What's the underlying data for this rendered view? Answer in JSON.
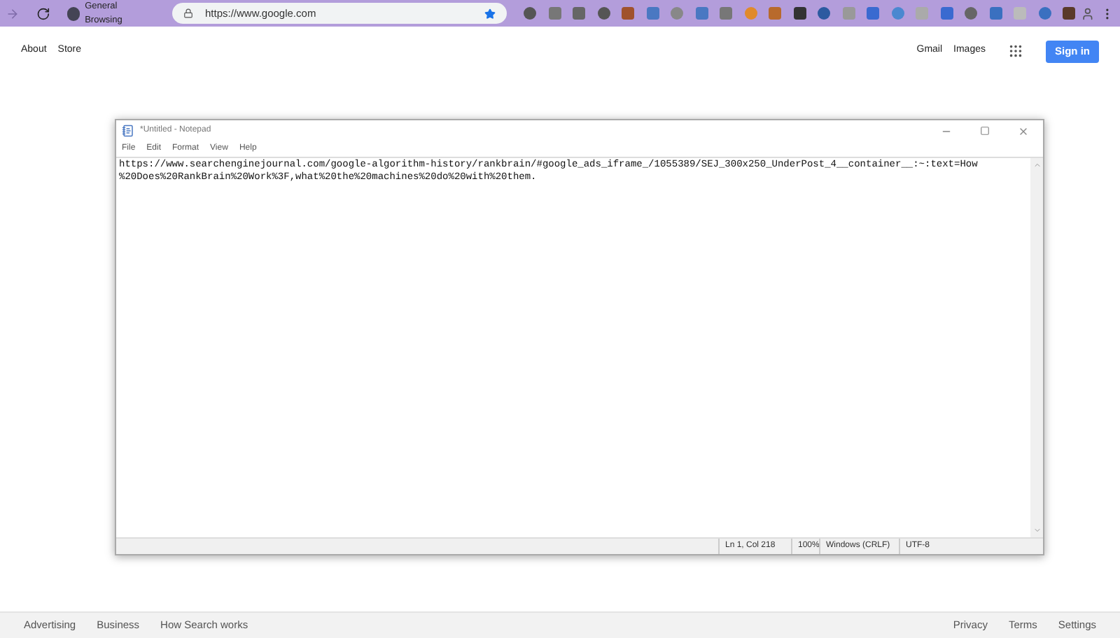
{
  "browser": {
    "tab_title": "General Browsing",
    "url": "https://www.google.com",
    "bookmarked": true
  },
  "google": {
    "top_links": [
      "About",
      "Store"
    ],
    "right_links": [
      "Gmail",
      "Images"
    ],
    "sign_in": "Sign in",
    "footer_left": [
      "Advertising",
      "Business",
      "How Search works"
    ],
    "footer_right": [
      "Privacy",
      "Terms",
      "Settings"
    ]
  },
  "notepad": {
    "title": "*Untitled - Notepad",
    "menu": [
      "File",
      "Edit",
      "Format",
      "View",
      "Help"
    ],
    "lines": [
      "https://www.searchenginejournal.com/google-algorithm-history/rankbrain/#google_ads_iframe_/1055389/SEJ_300x250_UnderPost_4__container__:~:text=How",
      "%20Does%20RankBrain%20Work%3F,what%20the%20machines%20do%20with%20them."
    ],
    "status": [
      "Ln 1, Col 218",
      "100%",
      "Windows (CRLF)",
      "UTF-8"
    ]
  }
}
